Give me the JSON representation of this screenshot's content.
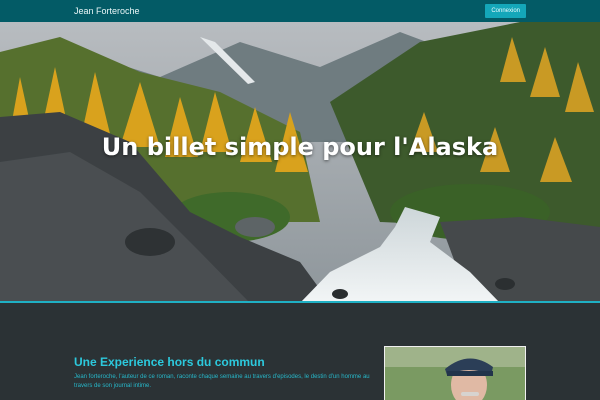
{
  "navbar": {
    "brand": "Jean Forteroche",
    "login_button": "Connexion"
  },
  "hero": {
    "title": "Un billet simple pour l'Alaska"
  },
  "intro": {
    "title": "Une Experience hors du commun",
    "text": "Jean forteroche, l'auteur de ce roman, raconte chaque semaine au travers d'episodes, le destin d'un homme au travers de son journal intime."
  },
  "colors": {
    "navbar": "#035b66",
    "accent": "#1fb0c4",
    "heading": "#2cc9dd",
    "background": "#2b3235"
  }
}
